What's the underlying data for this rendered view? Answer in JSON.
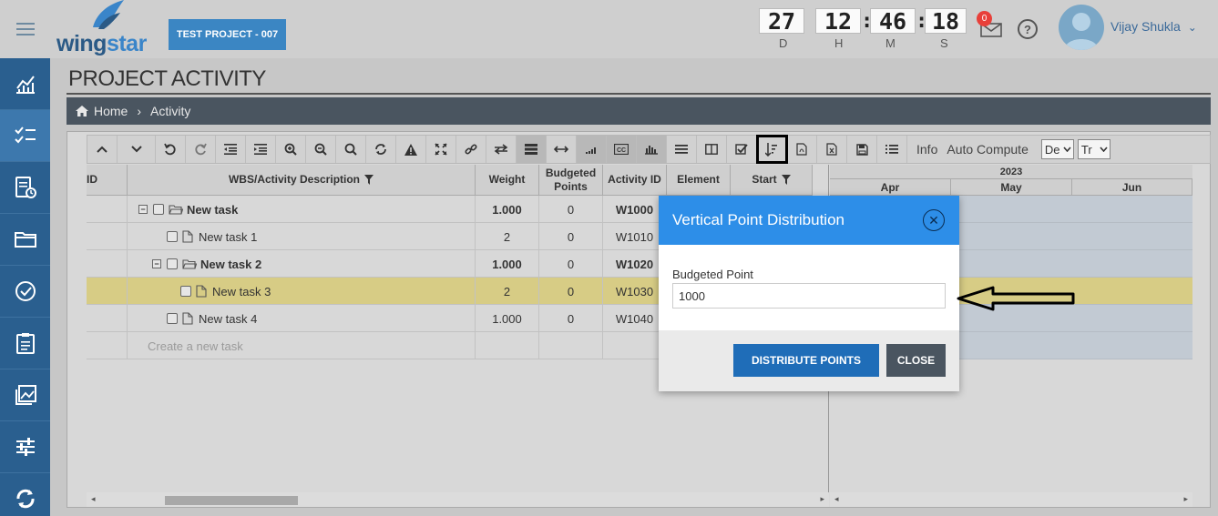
{
  "header": {
    "logo_text_a": "wing",
    "logo_text_b": "star",
    "project_button": "TEST PROJECT - 007",
    "countdown": {
      "days": "27",
      "hours": "12",
      "minutes": "46",
      "seconds": "18",
      "label_d": "D",
      "label_h": "H",
      "label_m": "M",
      "label_s": "S"
    },
    "notification_count": "0",
    "help_symbol": "?",
    "user_name": "Vijay Shukla",
    "user_chevron": "⌄"
  },
  "sidebar": {
    "items": [
      {
        "icon": "dashboard-chart-icon"
      },
      {
        "icon": "checklist-icon",
        "active": true
      },
      {
        "icon": "report-clock-icon"
      },
      {
        "icon": "folder-icon"
      },
      {
        "icon": "check-circle-icon"
      },
      {
        "icon": "clipboard-icon"
      },
      {
        "icon": "gallery-icon"
      },
      {
        "icon": "sliders-icon"
      },
      {
        "icon": "sync-icon"
      }
    ]
  },
  "page": {
    "title": "PROJECT ACTIVITY",
    "breadcrumb_home": "Home",
    "breadcrumb_sep": "›",
    "breadcrumb_current": "Activity"
  },
  "toolbar": {
    "info_label": "Info",
    "auto_compute_label": "Auto Compute",
    "select1_value": "De",
    "select2_value": "Tr"
  },
  "grid": {
    "headers": {
      "id": "ID",
      "description": "WBS/Activity Description",
      "weight": "Weight",
      "budgeted_points_line1": "Budgeted",
      "budgeted_points_line2": "Points",
      "activity_id": "Activity ID",
      "element": "Element",
      "start": "Start"
    },
    "rows": [
      {
        "description": "New task",
        "weight": "1.000",
        "points": "0",
        "activity_id": "W1000",
        "bold": true
      },
      {
        "description": "New task 1",
        "weight": "2",
        "points": "0",
        "activity_id": "W1010",
        "bold": false
      },
      {
        "description": "New task 2",
        "weight": "1.000",
        "points": "0",
        "activity_id": "W1020",
        "bold": true
      },
      {
        "description": "New task 3",
        "weight": "2",
        "points": "0",
        "activity_id": "W1030",
        "bold": false
      },
      {
        "description": "New task 4",
        "weight": "1.000",
        "points": "0",
        "activity_id": "W1040",
        "bold": false
      }
    ],
    "new_task_placeholder": "Create a new task"
  },
  "gantt": {
    "year": "2023",
    "months": [
      "Apr",
      "May",
      "Jun"
    ]
  },
  "modal": {
    "title": "Vertical Point Distribution",
    "close_symbol": "✕",
    "field_label": "Budgeted Point",
    "field_value": "1000",
    "distribute_button": "DISTRIBUTE POINTS",
    "close_button": "CLOSE"
  },
  "colors": {
    "brand_blue": "#2a5f8f",
    "modal_header": "#2d8ee8",
    "primary_button": "#1f6db8",
    "highlight_row": "#d7cc85"
  }
}
